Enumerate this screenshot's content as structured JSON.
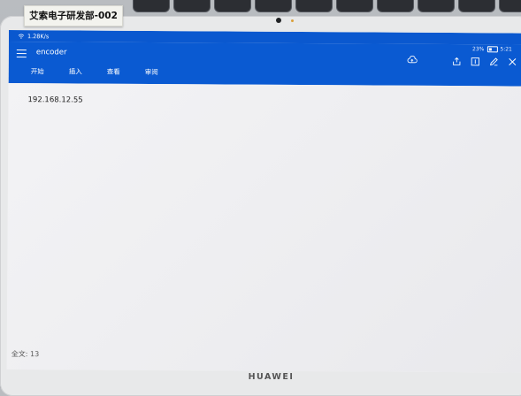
{
  "sticker_label": "艾索电子研发部-002",
  "status_bar": {
    "net_speed": "1.28K/s",
    "battery": "23%",
    "time": "5:21"
  },
  "app": {
    "title": "encoder",
    "tabs": [
      "开始",
      "插入",
      "查看",
      "审阅"
    ],
    "toolbar_icons": [
      "cloud-sync-icon",
      "share-icon",
      "page-icon",
      "edit-icon",
      "close-icon"
    ],
    "accent_color": "#0a5ad2"
  },
  "document": {
    "content": "192.168.12.55",
    "word_count": "全文: 13"
  },
  "device_brand": "HUAWEI"
}
